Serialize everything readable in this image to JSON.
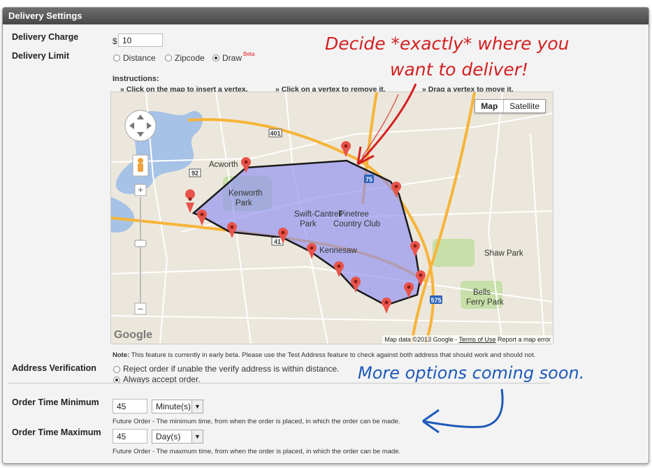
{
  "header": {
    "title": "Delivery Settings"
  },
  "delivery_charge": {
    "label": "Delivery Charge",
    "currency": "$",
    "value": "10"
  },
  "delivery_limit": {
    "label": "Delivery Limit",
    "options": [
      {
        "label": "Distance",
        "selected": false
      },
      {
        "label": "Zipcode",
        "selected": false
      },
      {
        "label": "Draw",
        "selected": true
      }
    ],
    "beta_tag": "Beta"
  },
  "instructions": {
    "title": "Instructions:",
    "items": [
      "» Click on the map to insert a vertex.",
      "» Click on a vertex to remove it.",
      "» Drag a vertex to move it."
    ]
  },
  "map": {
    "type_buttons": [
      "Map",
      "Satellite"
    ],
    "active_type": "Map",
    "attribution": "Map data ©2013 Google",
    "terms": "Terms of Use",
    "report": "Report a map error",
    "logo": "Google",
    "places": [
      "Acworth",
      "Kenworth Park",
      "Swift-Cantrell Park",
      "Pinetree Country Club",
      "Kennesaw",
      "Shaw Park",
      "Bells Ferry Park"
    ],
    "route_labels": [
      "75",
      "575",
      "92",
      "41",
      "401"
    ],
    "colors": {
      "polygon_fill": "#8f8ff2",
      "polygon_stroke": "#1a1a1a",
      "marker": "#e8534a",
      "highway": "#f7b43a",
      "water": "#a6c2e6",
      "park": "#c7dfa8"
    }
  },
  "note": {
    "bold": "Note:",
    "text": " This feature is currently in early beta. Please use the Test Address feature to check against both address that should work and should not."
  },
  "address_verification": {
    "label": "Address Verification",
    "options": [
      {
        "label": "Reject order if unable the verify address is within distance.",
        "selected": false
      },
      {
        "label": "Always accept order.",
        "selected": true
      }
    ]
  },
  "order_time_min": {
    "label": "Order Time Minimum",
    "value": "45",
    "unit": "Minute(s)",
    "help": "Future Order - The minimum time, from when the order is placed, in which the order can be made."
  },
  "order_time_max": {
    "label": "Order Time Maximum",
    "value": "45",
    "unit": "Day(s)",
    "help": "Future Order - The maxmum time, from when the order is placed, in which the order can be made."
  },
  "annotations": {
    "red_line1": "Decide *exactly* where you",
    "red_line2": "want to deliver!",
    "blue_line": "More options coming soon."
  }
}
